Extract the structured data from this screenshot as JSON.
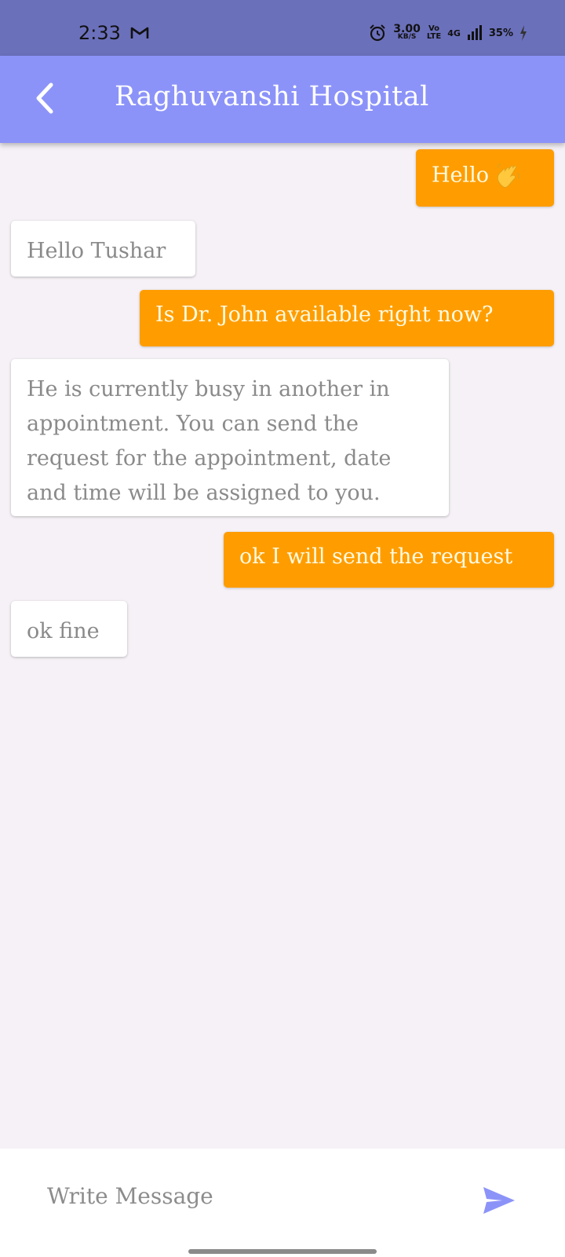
{
  "status_bar": {
    "time": "2:33",
    "network_speed_value": "3.00",
    "network_speed_unit": "KB/S",
    "volte_top": "Vo",
    "volte_bottom": "LTE",
    "network_type": "4G",
    "battery": "35%"
  },
  "header": {
    "title": "Raghuvanshi Hospital"
  },
  "messages": [
    {
      "sender": "me",
      "text": "Hello"
    },
    {
      "sender": "hospital",
      "text": "Hello Tushar"
    },
    {
      "sender": "me",
      "text": "Is Dr. John available right now?"
    },
    {
      "sender": "hospital",
      "text": "He is currently busy in another in appointment. You can send the request for the appointment, date and time will be assigned to you."
    },
    {
      "sender": "me",
      "text": "ok I will send the request"
    },
    {
      "sender": "hospital",
      "text": "ok fine"
    }
  ],
  "composer": {
    "placeholder": "Write Message"
  },
  "colors": {
    "status_bar": "#6b70bb",
    "app_bar": "#8c93f8",
    "sent_bubble": "#ff9d00",
    "received_bubble": "#ffffff",
    "background": "#f5f1f6",
    "send_icon": "#8c93f8"
  },
  "icons": {
    "back": "chevron-left-icon",
    "send": "send-icon",
    "wave": "waving-hand-icon",
    "mail": "gmail-icon",
    "alarm": "alarm-icon"
  }
}
